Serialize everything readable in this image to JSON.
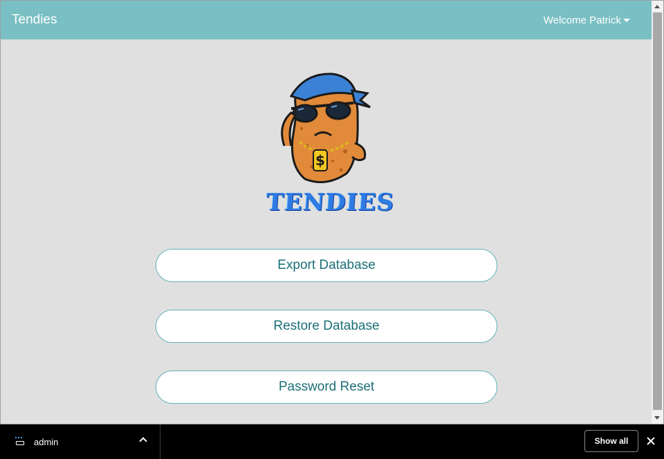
{
  "navbar": {
    "brand": "Tendies",
    "user_menu_label": "Welcome Patrick"
  },
  "logo": {
    "text": "TENDIES",
    "icon": "tendies-mascot-logo"
  },
  "actions": [
    {
      "label": "Export Database"
    },
    {
      "label": "Restore Database"
    },
    {
      "label": "Password Reset"
    }
  ],
  "download_bar": {
    "file_name": "admin",
    "show_all_label": "Show all"
  },
  "colors": {
    "navbar": "#79bfc3",
    "page_background": "#e0e0e0",
    "button_border": "#5fb2b8",
    "button_text": "#1b6f77",
    "download_bar": "#000000"
  }
}
